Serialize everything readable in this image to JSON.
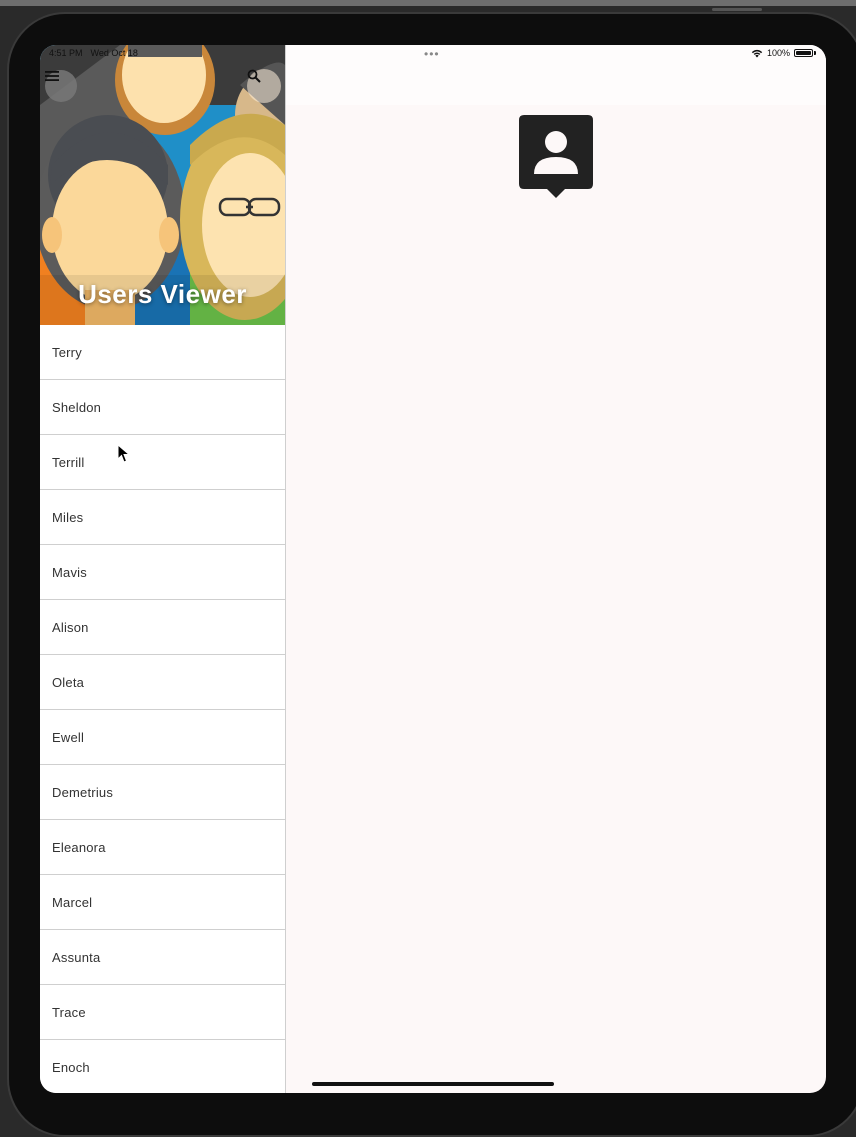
{
  "status_bar": {
    "time": "4:51 PM",
    "date": "Wed Oct 18",
    "battery": "100%",
    "multitask_dots": "•••"
  },
  "header": {
    "title": "Users Viewer",
    "menu_icon": "hamburger-menu-icon",
    "search_icon": "search-icon"
  },
  "users": [
    "Terry",
    "Sheldon",
    "Terrill",
    "Miles",
    "Mavis",
    "Alison",
    "Oleta",
    "Ewell",
    "Demetrius",
    "Eleanora",
    "Marcel",
    "Assunta",
    "Trace",
    "Enoch"
  ],
  "detail": {
    "placeholder_icon": "person-pin-icon",
    "icon_color": "#222222"
  }
}
